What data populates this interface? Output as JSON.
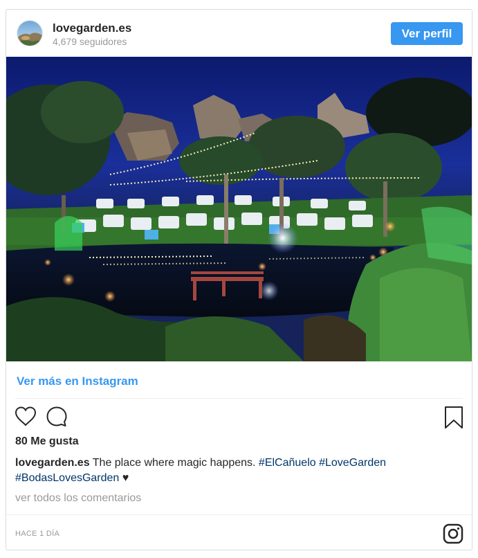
{
  "header": {
    "username": "lovegarden.es",
    "followers": "4,679 seguidores",
    "profile_button": "Ver perfil"
  },
  "post": {
    "view_more_link": "Ver más en Instagram",
    "likes": "80 Me gusta",
    "caption": {
      "user": "lovegarden.es",
      "text": "The place where magic happens.",
      "hashtags": [
        "#ElCañuelo",
        "#LoveGarden",
        "#BodasLovesGarden"
      ],
      "emoji": "♥"
    },
    "view_comments": "ver todos los comentarios",
    "timestamp": "HACE 1 DÍA"
  },
  "icons": {
    "like": "heart-icon",
    "comment": "comment-icon",
    "save": "bookmark-icon",
    "brand": "instagram-icon"
  },
  "colors": {
    "accent": "#3897f0",
    "hashtag": "#003569",
    "muted": "#999999"
  }
}
